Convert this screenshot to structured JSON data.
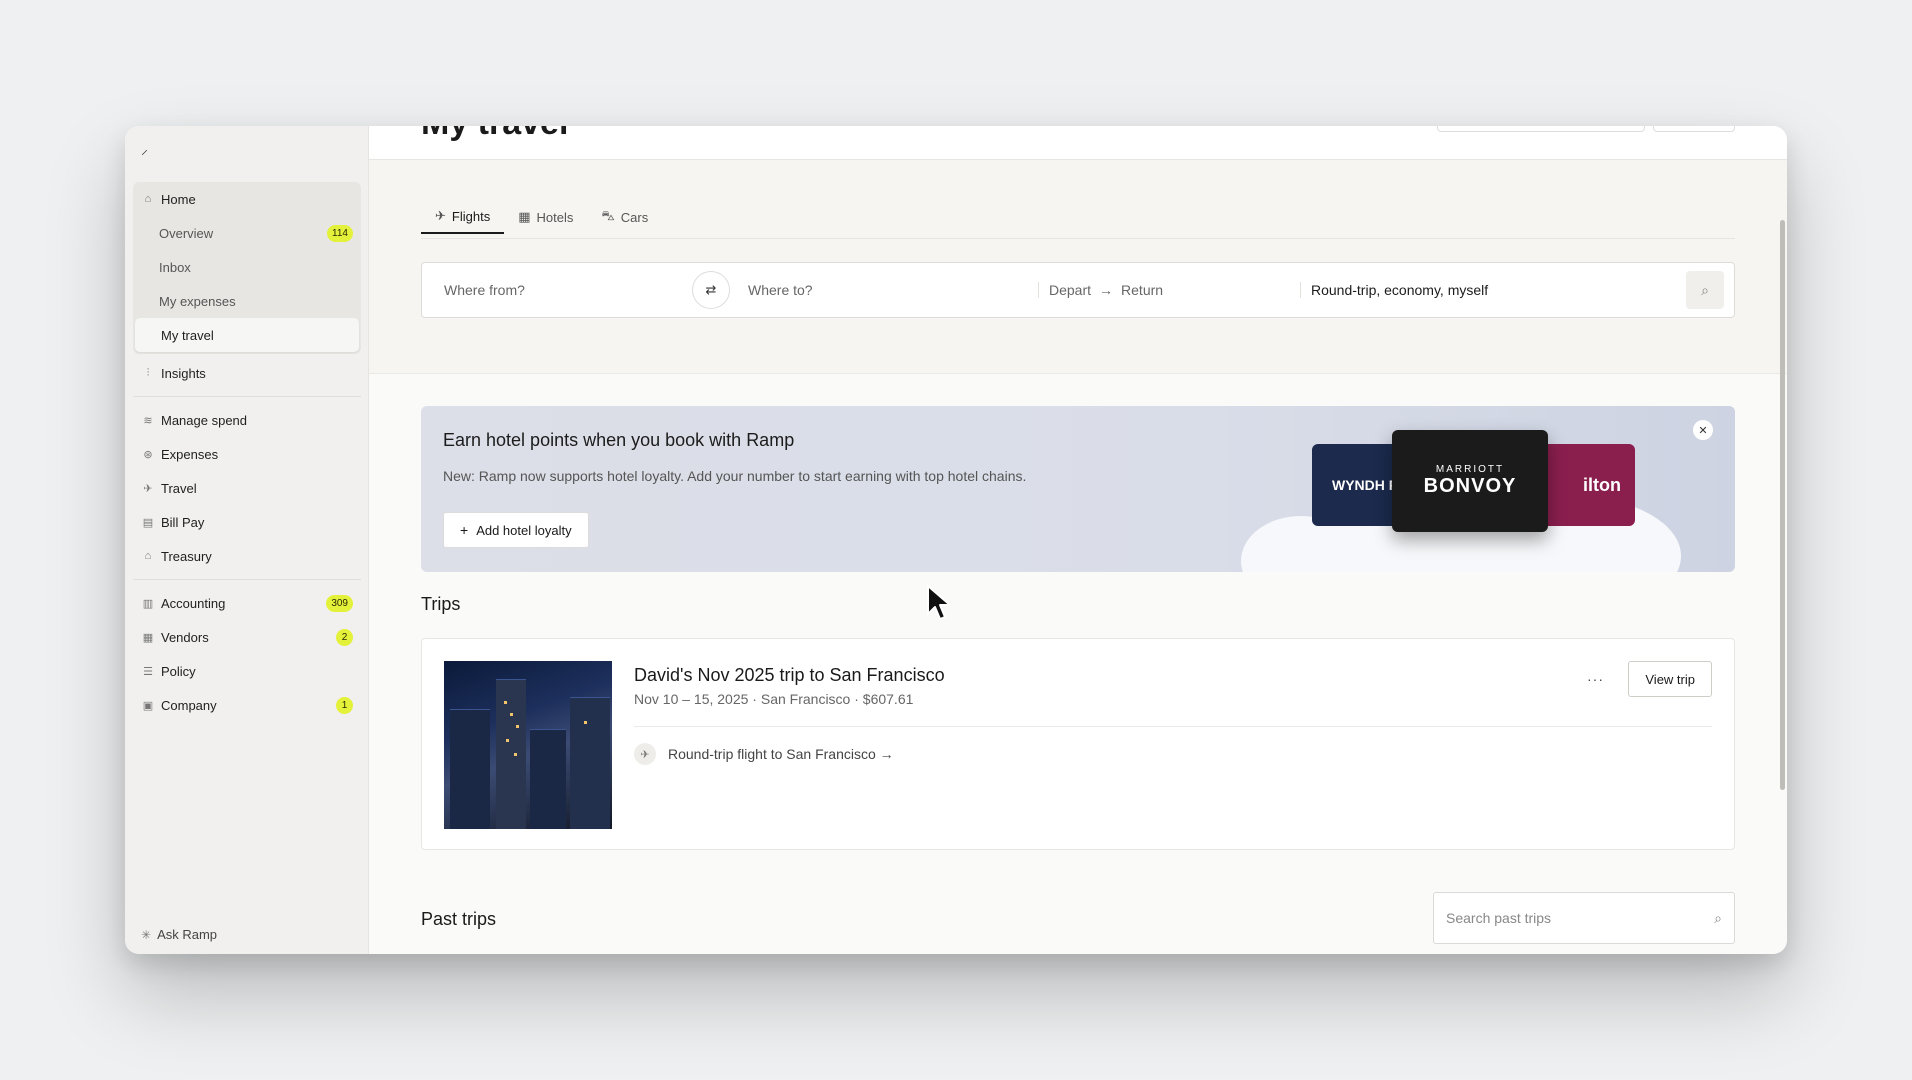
{
  "page": {
    "title": "My travel"
  },
  "sidebar": {
    "items": [
      {
        "label": "Home",
        "icon": "home-icon"
      },
      {
        "label": "Overview",
        "badge": "114"
      },
      {
        "label": "Inbox"
      },
      {
        "label": "My expenses"
      },
      {
        "label": "My travel"
      },
      {
        "label": "Insights",
        "icon": "bar-chart-icon"
      },
      {
        "label": "Manage spend",
        "icon": "layers-icon"
      },
      {
        "label": "Expenses",
        "icon": "dollar-circle-icon"
      },
      {
        "label": "Travel",
        "icon": "plane-icon"
      },
      {
        "label": "Bill Pay",
        "icon": "receipt-icon"
      },
      {
        "label": "Treasury",
        "icon": "bank-icon"
      },
      {
        "label": "Accounting",
        "icon": "book-icon",
        "badge": "309"
      },
      {
        "label": "Vendors",
        "icon": "building-icon",
        "badge": "2"
      },
      {
        "label": "Policy",
        "icon": "sliders-icon"
      },
      {
        "label": "Company",
        "icon": "office-icon",
        "badge": "1"
      }
    ],
    "ask": "Ask Ramp"
  },
  "tabs": [
    "Flights",
    "Hotels",
    "Cars"
  ],
  "search": {
    "from_placeholder": "Where from?",
    "to_placeholder": "Where to?",
    "depart": "Depart",
    "return": "Return",
    "options": "Round-trip, economy, myself"
  },
  "promo": {
    "title": "Earn hotel points when you book with Ramp",
    "text": "New: Ramp now supports hotel loyalty. Add your number to start earning with top hotel chains.",
    "button": "Add hotel loyalty",
    "cards": {
      "wyndham": "WYNDH REWAR",
      "marriott_small": "MARRIOTT",
      "marriott_big": "BONVOY",
      "hilton": "ilton"
    }
  },
  "trips": {
    "heading": "Trips",
    "items": [
      {
        "title": "David's Nov 2025 trip to San Francisco",
        "details": "Nov 10 – 15, 2025 · San Francisco · $607.61",
        "view": "View trip",
        "flight": "Round-trip flight to San Francisco →"
      }
    ]
  },
  "past_trips": {
    "heading": "Past trips",
    "search_placeholder": "Search past trips"
  },
  "colors": {
    "badge": "#e4f13a",
    "sidebar_bg": "#f1f0ee",
    "promo_bg": "#d9dde8"
  }
}
